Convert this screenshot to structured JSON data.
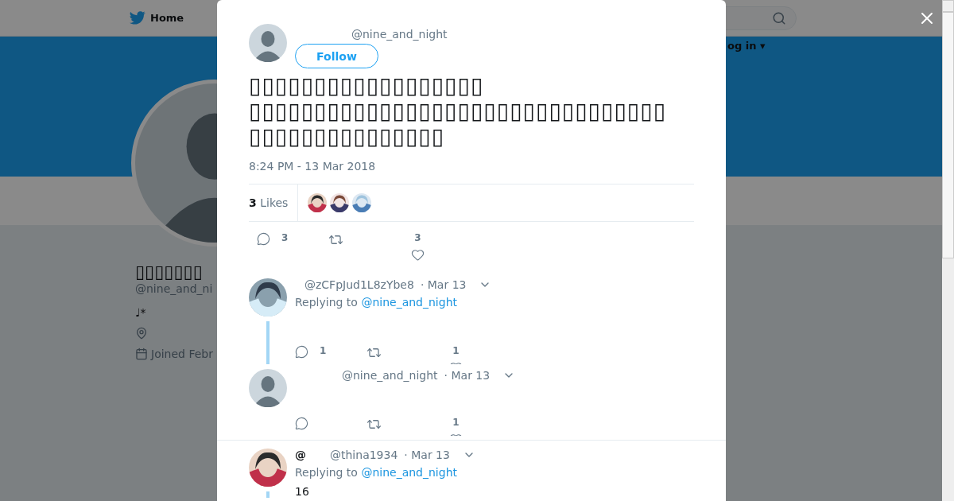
{
  "background": {
    "header": {
      "home": "Home",
      "login": "og in ▾"
    },
    "profile": {
      "name": "▯▯▯▯▯▯▯",
      "handle": "@nine_and_ni",
      "bio": "♩*",
      "joined": "Joined Febr"
    }
  },
  "tweet": {
    "handle": "@nine_and_night",
    "follow": "Follow",
    "text_lines": [
      "▯▯▯▯▯▯▯▯▯▯▯▯▯▯▯▯▯▯",
      "▯▯▯▯▯▯▯▯▯▯▯▯▯▯▯▯▯▯▯▯▯▯▯▯▯▯▯▯▯▯▯▯",
      "▯▯▯▯▯▯▯▯▯▯▯▯▯▯▯"
    ],
    "timestamp": "8:24 PM - 13 Mar 2018",
    "likes_count": "3",
    "likes_label": "Likes",
    "replies": "3",
    "likes": "3"
  },
  "replies": [
    {
      "handle": "@zCFpJud1L8zYbe8",
      "date": "· Mar 13",
      "replying_label": "Replying to",
      "replying_handle": "@nine_and_night",
      "replies": "1",
      "likes": "1",
      "thread_line": true,
      "divider": false
    },
    {
      "avatar": {
        "kind": "default"
      },
      "handle": "@nine_and_night",
      "date": "· Mar 13",
      "likes": "1",
      "thread_line": false,
      "divider": true
    },
    {
      "name": "@",
      "handle": "@thina1934",
      "date": "· Mar 13",
      "replying_label": "Replying to",
      "replying_handle": "@nine_and_night",
      "text": "16",
      "thread_line": true,
      "divider": false
    }
  ]
}
